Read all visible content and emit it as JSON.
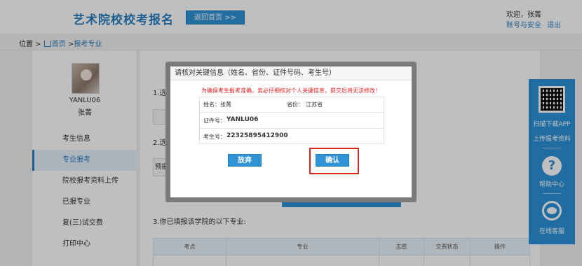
{
  "header": {
    "site_title": "艺术院校校考报名",
    "home_button": "返回首页 >>",
    "welcome": "欢迎，张菁",
    "account_link": "账号与安全",
    "logout_link": "退出"
  },
  "breadcrumb": {
    "prefix": "位置 >",
    "home": "首页",
    "sep": ">",
    "current": "报考专业"
  },
  "sidebar": {
    "username": "YANLU06",
    "realname": "张菁",
    "items": [
      {
        "label": "考生信息",
        "active": false
      },
      {
        "label": "专业报考",
        "active": true
      },
      {
        "label": "院校报考资料上传",
        "active": false
      },
      {
        "label": "已报专业",
        "active": false
      },
      {
        "label": "复(三)试交费",
        "active": false
      },
      {
        "label": "打印中心",
        "active": false
      }
    ]
  },
  "main": {
    "step1": "1.选",
    "step2": "2.选",
    "step2_select": "预报",
    "step3": "3.你已填报该学院的以下专业:",
    "table_headers": [
      "考点",
      "专业",
      "志愿",
      "交费状态",
      "操作"
    ]
  },
  "float_panel": {
    "scan_label": "扫描下载APP",
    "upload_label": "上传报考资料",
    "help_label": "帮助中心",
    "service_label": "在线客服",
    "help_glyph": "?"
  },
  "modal": {
    "title": "请核对关键信息（姓名、省份、证件号码、考生号）",
    "warning": "为确保考生报考准确，务必仔细核对个人关键信息，提交后将无法修改！",
    "name_label": "姓名：",
    "name_value": "张菁",
    "province_label": "省份：",
    "province_value": "江苏省",
    "id_label": "证件号：",
    "id_value": "YANLU06",
    "exam_label": "考生号：",
    "exam_value": "22325895412900",
    "cancel_button": "放弃",
    "confirm_button": "确认"
  },
  "colors": {
    "primary": "#2f93d6",
    "title_blue": "#2a7fc0",
    "warning_red": "#e02020",
    "highlight_red": "#d9261c"
  }
}
